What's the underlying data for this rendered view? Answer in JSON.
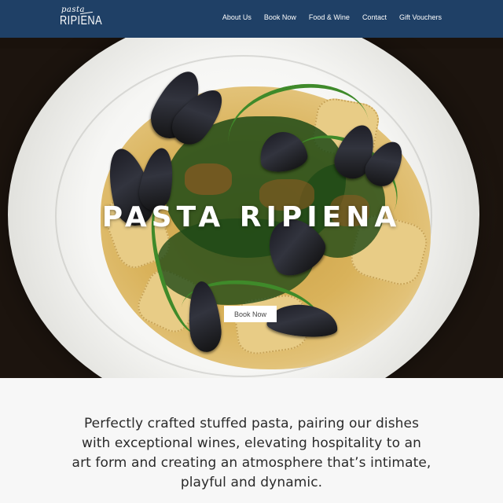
{
  "header": {
    "logo_script": "pasta",
    "logo_main": "RIPIENA",
    "nav": [
      {
        "label": "About Us"
      },
      {
        "label": "Book Now"
      },
      {
        "label": "Food & Wine"
      },
      {
        "label": "Contact"
      },
      {
        "label": "Gift Vouchers"
      }
    ],
    "bg_color": "#1f4066"
  },
  "hero": {
    "title": "PASTA RIPIENA",
    "cta_label": "Book Now"
  },
  "about": {
    "text": "Perfectly crafted stuffed pasta, pairing our dishes with exceptional wines, elevating hospitality to an art form and creating an atmosphere that’s intimate, playful and dynamic."
  }
}
